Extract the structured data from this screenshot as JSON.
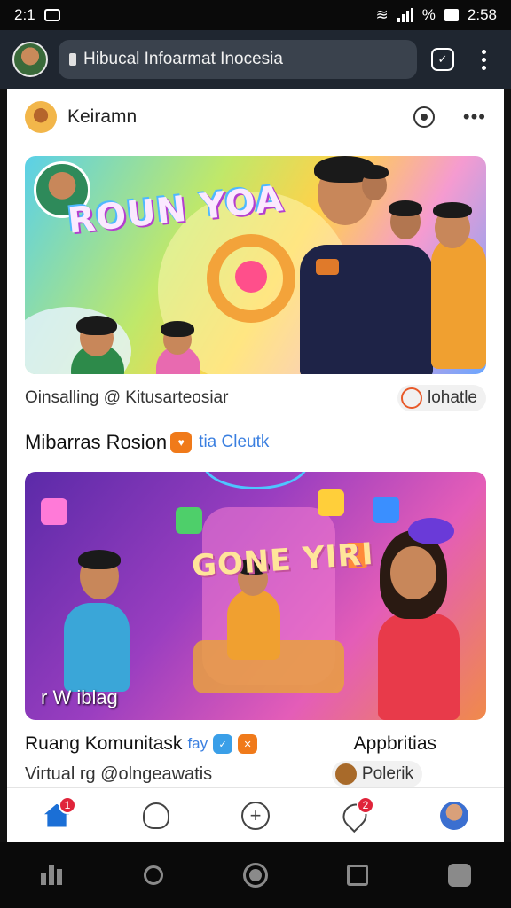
{
  "status_bar": {
    "time": "2:1",
    "right_time": "2:58",
    "battery_pct": "%"
  },
  "browser": {
    "url": "Hibucal Infoarmat Inocesia"
  },
  "post_header": {
    "name": "Keiramn"
  },
  "card1": {
    "headline": "ROUN YOA",
    "caption": "Oinsalling @ Kitusarteosiar",
    "chip_label": "lohatle"
  },
  "section": {
    "title": "Mibarras Rosion",
    "subtitle": "tia Cleutk"
  },
  "card2": {
    "headline": "GONE YIRI",
    "overlay_text": "r W iblag",
    "caption_left": "Ruang Komunitask",
    "badge_text": "fay",
    "caption_right": "Appbritias",
    "caption_sub": "Virtual rg @olngeawatis",
    "chip_label": "Polerik"
  },
  "bottom_nav": {
    "home_badge": "1",
    "notif_badge": "2"
  },
  "colors": {
    "accent": "#1b6fd6",
    "badge": "#e0243a",
    "orange": "#f07a1a",
    "link": "#3a7fe0"
  }
}
